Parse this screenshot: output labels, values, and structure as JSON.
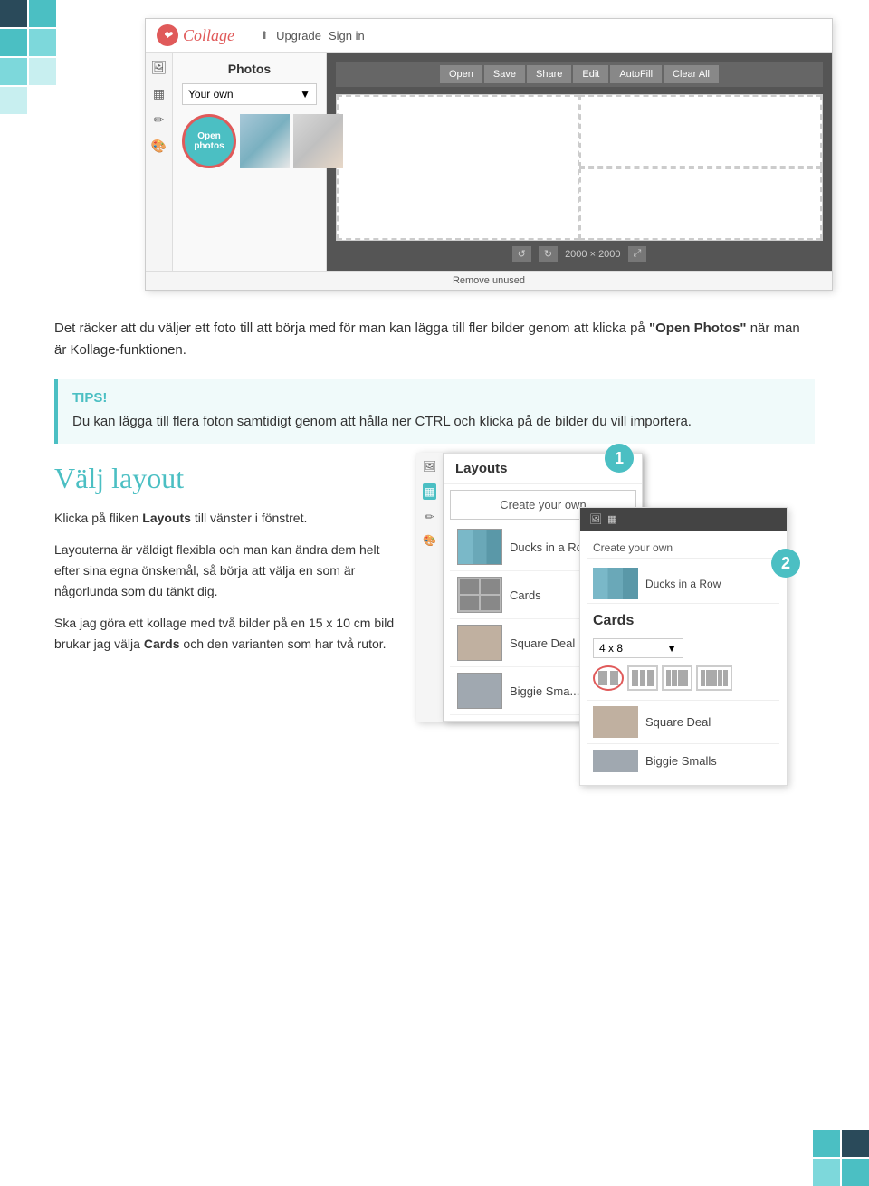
{
  "app": {
    "logo_text": "Collage",
    "nav": {
      "upgrade": "Upgrade",
      "sign_in": "Sign in"
    },
    "sidebar": {
      "photos_title": "Photos",
      "dropdown_value": "Your own",
      "open_photos_label": "Open photos"
    },
    "canvas_toolbar": {
      "open": "Open",
      "save": "Save",
      "share": "Share",
      "edit": "Edit",
      "autofill": "AutoFill",
      "clear_all": "Clear All"
    },
    "canvas_status": {
      "dimensions": "2000 × 2000"
    },
    "remove_unused": "Remove unused"
  },
  "intro_text": "Det räcker att du väljer ett foto till att börja med för man kan lägga till fler bilder genom att klicka på",
  "intro_bold": "\"Open Photos\"",
  "intro_text2": "när man är Kollage-funktionen.",
  "tips": {
    "title": "TIPS!",
    "text": "Du kan lägga till flera foton samtidigt genom att hålla ner CTRL och klicka på de bilder du vill importera."
  },
  "layout_section": {
    "heading": "Välj layout",
    "para1": "Klicka på fliken",
    "para1_bold": "Layouts",
    "para1_rest": "till vänster i fönstret.",
    "para2": "Layouterna är väldigt flexibla och man kan ändra dem helt efter sina egna önskemål, så börja att välja en som är någorlunda som du tänkt dig.",
    "para3_start": "Ska jag göra ett kollage med två bilder på en 15 x 10 cm bild brukar jag välja",
    "para3_bold": "Cards",
    "para3_end": "och den varianten som har två rutor."
  },
  "layouts_panel": {
    "title": "Layouts",
    "create_your_own": "Create your own",
    "items": [
      {
        "name": "Ducks in a Row"
      },
      {
        "name": "Cards"
      },
      {
        "name": "Square Deal"
      },
      {
        "name": "Biggie Sma..."
      }
    ]
  },
  "cards_panel": {
    "create_your_own": "Create your own",
    "ducks_in_a_row": "Ducks in a Row",
    "cards_title": "Cards",
    "size": "4 x 8",
    "square_deal": "Square Deal",
    "biggie_smalls": "Biggie Smalls"
  },
  "badges": {
    "one": "1",
    "two": "2"
  }
}
